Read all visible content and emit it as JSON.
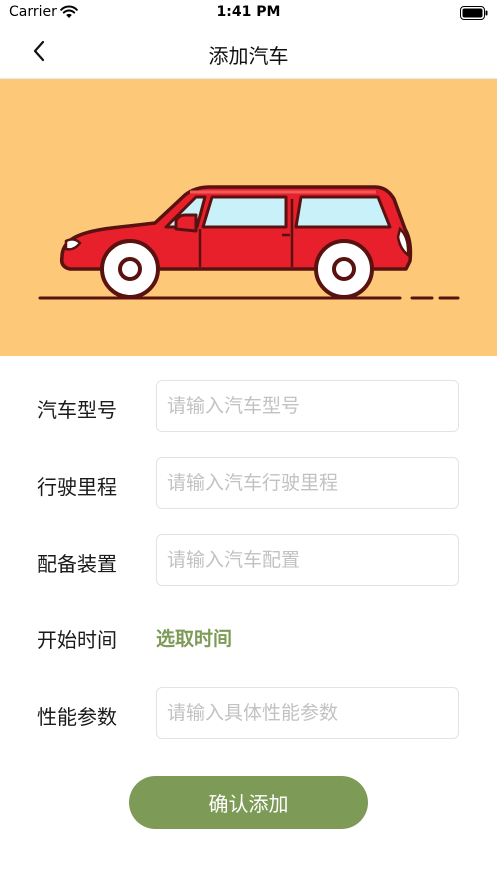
{
  "status_bar": {
    "carrier": "Carrier",
    "time": "1:41 PM"
  },
  "nav": {
    "title": "添加汽车",
    "back_icon": "chevron-left-icon"
  },
  "hero": {
    "image": "red-car-illustration",
    "background_color": "#FDC878",
    "car_color": "#E8202B"
  },
  "form": {
    "model": {
      "label": "汽车型号",
      "placeholder": "请输入汽车型号",
      "value": ""
    },
    "mileage": {
      "label": "行驶里程",
      "placeholder": "请输入汽车行驶里程",
      "value": ""
    },
    "equipment": {
      "label": "配备装置",
      "placeholder": "请输入汽车配置",
      "value": ""
    },
    "start_time": {
      "label": "开始时间",
      "picker_label": "选取时间"
    },
    "performance": {
      "label": "性能参数",
      "placeholder": "请输入具体性能参数",
      "value": ""
    }
  },
  "confirm_button": {
    "label": "确认添加"
  },
  "colors": {
    "accent": "#7D9A56",
    "border": "#E3E3E3",
    "placeholder": "#C2C2C2"
  }
}
